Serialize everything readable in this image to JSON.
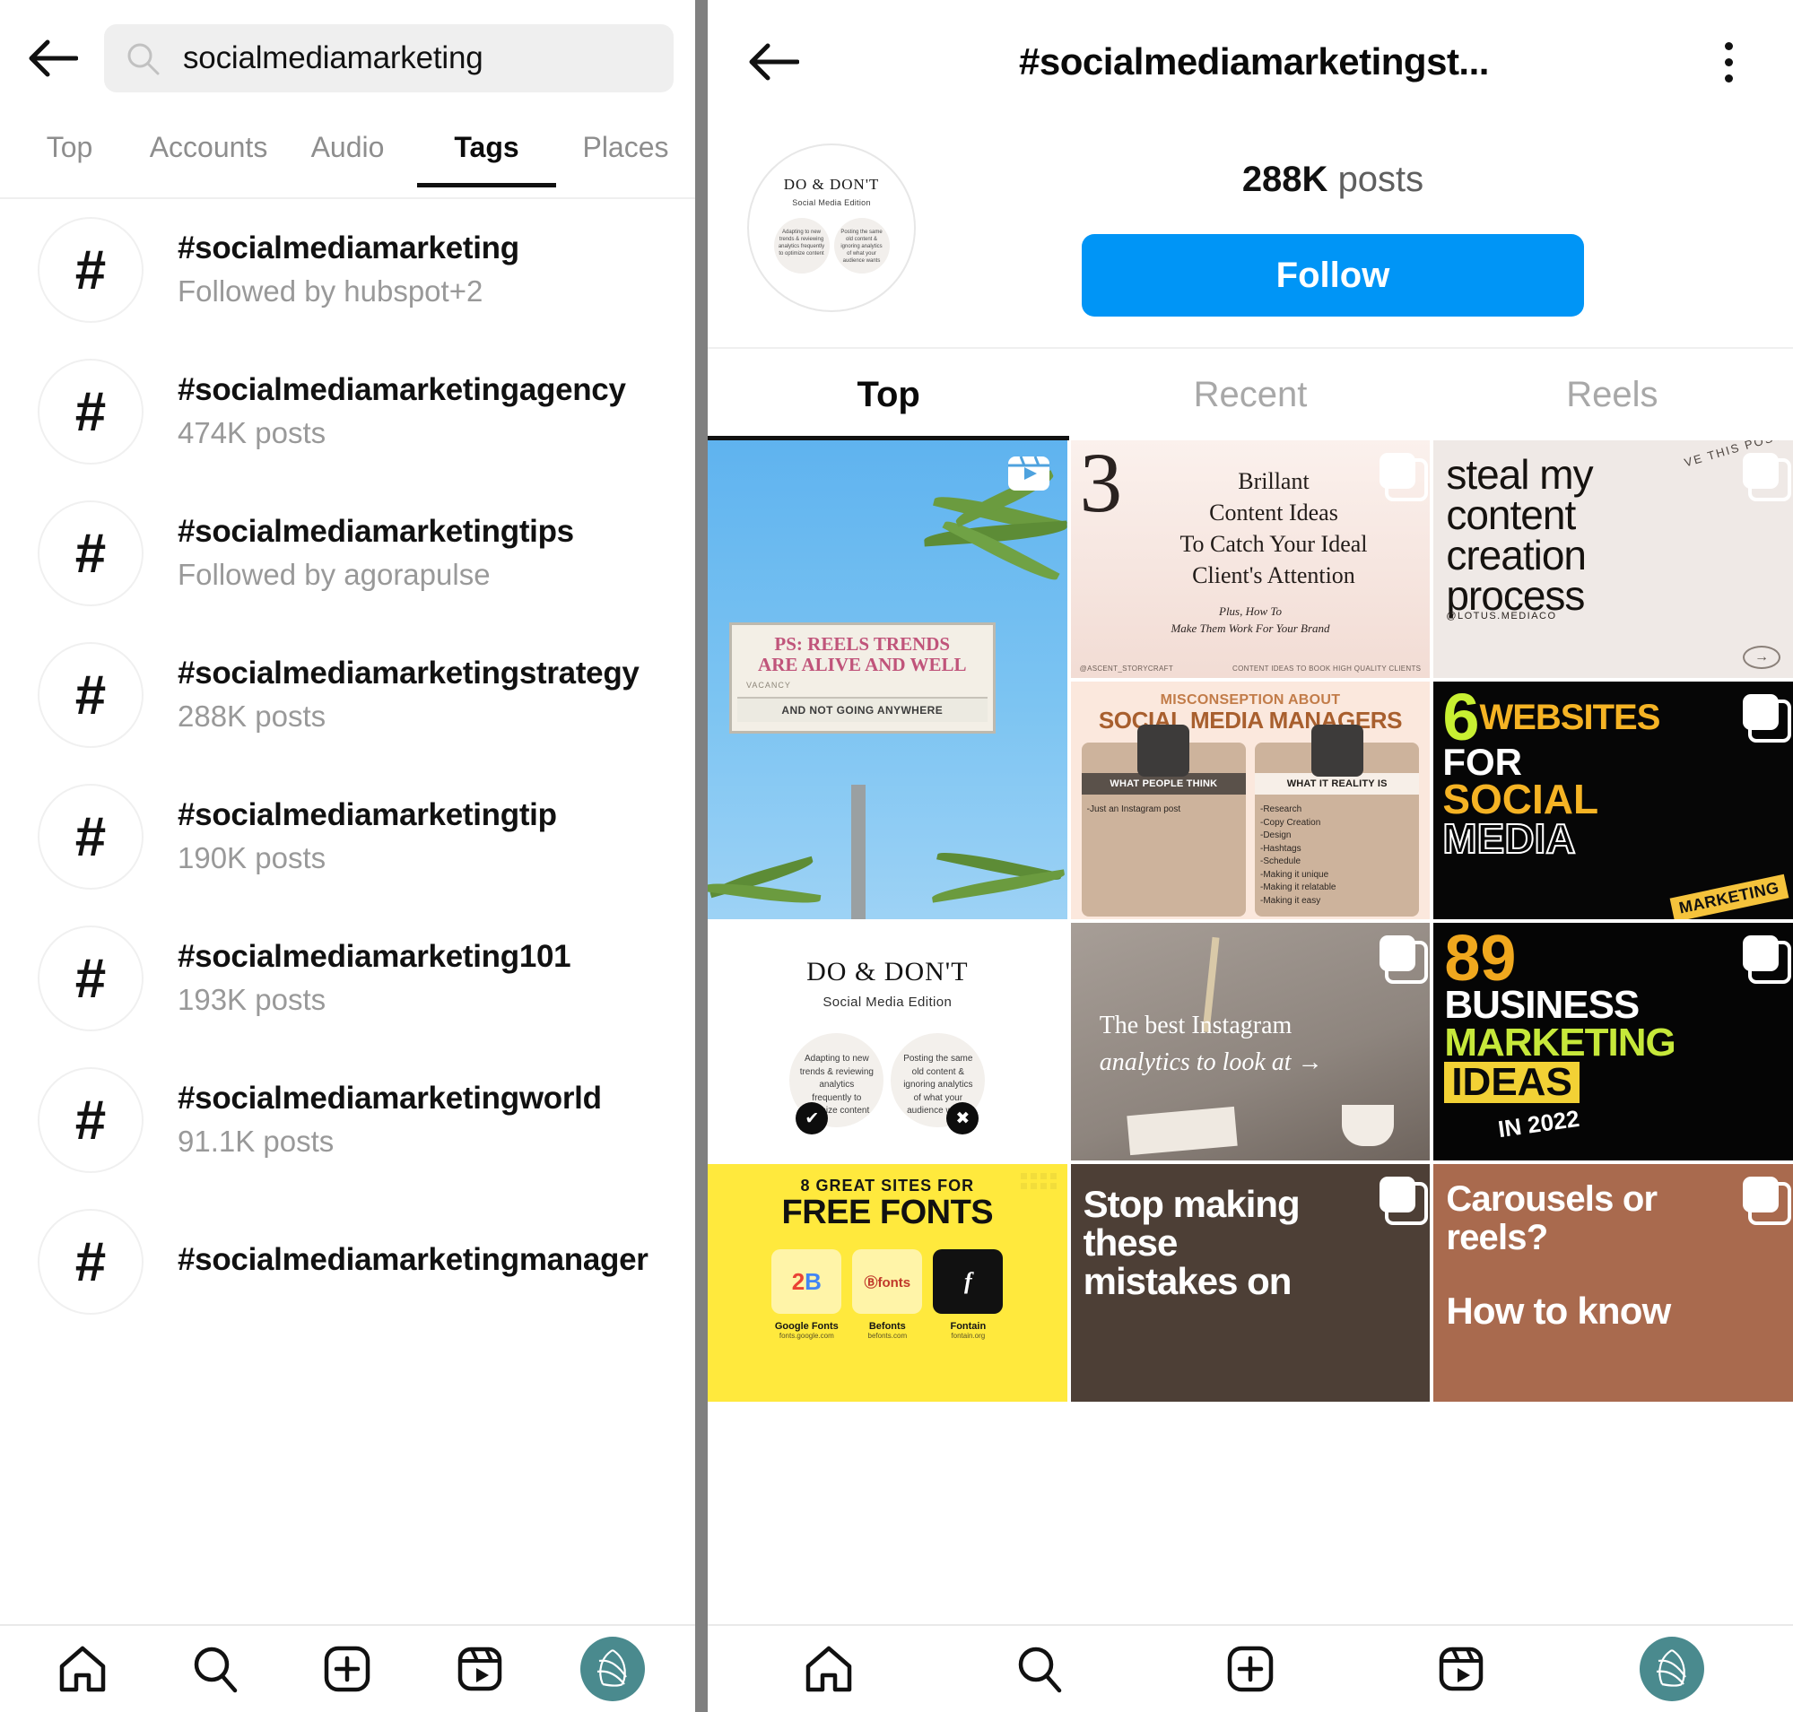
{
  "left": {
    "search": {
      "value": "socialmediamarketing",
      "placeholder": "Search"
    },
    "tabs": [
      {
        "label": "Top",
        "active": false
      },
      {
        "label": "Accounts",
        "active": false
      },
      {
        "label": "Audio",
        "active": false
      },
      {
        "label": "Tags",
        "active": true
      },
      {
        "label": "Places",
        "active": false
      }
    ],
    "hash_glyph": "#",
    "tags": [
      {
        "name": "#socialmediamarketing",
        "sub": "Followed by hubspot+2"
      },
      {
        "name": "#socialmediamarketingagency",
        "sub": "474K posts"
      },
      {
        "name": "#socialmediamarketingtips",
        "sub": "Followed by agorapulse"
      },
      {
        "name": "#socialmediamarketingstrategy",
        "sub": "288K posts"
      },
      {
        "name": "#socialmediamarketingtip",
        "sub": "190K posts"
      },
      {
        "name": "#socialmediamarketing101",
        "sub": "193K posts"
      },
      {
        "name": "#socialmediamarketingworld",
        "sub": "91.1K posts"
      },
      {
        "name": "#socialmediamarketingmanager",
        "sub": ""
      }
    ],
    "bottom_nav": [
      {
        "icon": "home-icon",
        "label": "Home"
      },
      {
        "icon": "search-icon",
        "label": "Search"
      },
      {
        "icon": "create-icon",
        "label": "Create"
      },
      {
        "icon": "reels-icon",
        "label": "Reels"
      },
      {
        "icon": "profile-avatar-icon",
        "label": "Profile"
      }
    ]
  },
  "right": {
    "title": "#socialmediamarketingst...",
    "back_icon": "back-arrow-icon",
    "menu_icon": "overflow-menu-icon",
    "posts_count": "288K",
    "posts_label": "posts",
    "follow_label": "Follow",
    "follow_color": "#0095f6",
    "avatar": {
      "title": "DO & DON'T",
      "subtitle": "Social Media Edition",
      "left_text": "Adapting to new trends & reviewing analytics frequently to optimize content",
      "right_text": "Posting the same old content & ignoring analytics of what your audience wants",
      "left_badge": "✔",
      "right_badge": "✖"
    },
    "tabs": [
      {
        "label": "Top",
        "active": true
      },
      {
        "label": "Recent",
        "active": false
      },
      {
        "label": "Reels",
        "active": false
      }
    ],
    "grid": [
      {
        "type": "reel",
        "badge": "reels-badge-icon",
        "board_line1": "PS: REELS TRENDS",
        "board_line1b": "ARE ALIVE AND WELL",
        "board_line2": "AND NOT GOING ANYWHERE",
        "board_vacancy": "VACANCY"
      },
      {
        "type": "carousel",
        "badge": "carousel-badge-icon",
        "num": "3",
        "l1": "Brillant",
        "l2": "Content Ideas",
        "l3": "To Catch Your Ideal",
        "l4": "Client's Attention",
        "plus1": "Plus, How To",
        "plus2": "Make Them Work For Your Brand",
        "foot_left": "@ASCENT_STORYCRAFT",
        "foot_right": "CONTENT IDEAS TO BOOK HIGH QUALITY CLIENTS"
      },
      {
        "type": "carousel",
        "badge": "carousel-badge-icon",
        "l1": "steal my",
        "l2": "content",
        "l3": "creation",
        "l4": "process",
        "handle": "@LOTUS.MEDIACO",
        "corner": "VE THIS POST",
        "arrow": "→"
      },
      {
        "type": "image",
        "title_top": "MISCONSEPTION ABOUT",
        "title_main": "SOCIAL MEDIA MANAGERS",
        "left_cap": "WHAT PEOPLE THINK",
        "left_body": "-Just an Instagram post",
        "right_cap": "WHAT IT REALITY IS",
        "right_body": "-Research\n-Copy Creation\n-Design\n-Hashtags\n-Schedule\n-Making it unique\n-Making it relatable\n-Making it easy"
      },
      {
        "type": "carousel",
        "badge": "carousel-badge-icon",
        "n": "6",
        "w": "WEBSITES",
        "l2": "FOR",
        "l3": "SOCIAL",
        "l4": "MEDIA",
        "stamp": "MARKETING"
      },
      {
        "type": "image",
        "title": "DO & DON'T",
        "subtitle": "Social Media Edition",
        "left_text": "Adapting to new trends & reviewing analytics frequently to optimize content",
        "right_text": "Posting the same old content & ignoring analytics of what your audience wants",
        "left_badge": "✔",
        "right_badge": "✖"
      },
      {
        "type": "carousel",
        "badge": "carousel-badge-icon",
        "l1": "The best Instagram",
        "l2": "analytics to look at →"
      },
      {
        "type": "carousel",
        "badge": "carousel-badge-icon",
        "n": "89",
        "b1": "BUSINESS",
        "b2": "MARKETING",
        "b3": "IDEAS",
        "yr": "IN 2022"
      },
      {
        "type": "image",
        "h1": "8 GREAT SITES FOR",
        "h2": "FREE FONTS",
        "cards": [
          {
            "name": "Google Fonts",
            "url": "fonts.google.com"
          },
          {
            "name": "Befonts",
            "url": "befonts.com"
          },
          {
            "name": "Fontain",
            "url": "fontain.org"
          }
        ]
      },
      {
        "type": "carousel",
        "badge": "carousel-badge-icon",
        "l1": "Stop making",
        "l2": "these",
        "l3": "mistakes on"
      },
      {
        "type": "carousel",
        "badge": "carousel-badge-icon",
        "l1": "Carousels or",
        "l2": "reels?",
        "l3": "How to know"
      }
    ],
    "bottom_nav": [
      {
        "icon": "home-icon",
        "label": "Home"
      },
      {
        "icon": "search-icon",
        "label": "Search"
      },
      {
        "icon": "create-icon",
        "label": "Create"
      },
      {
        "icon": "reels-icon",
        "label": "Reels"
      },
      {
        "icon": "profile-avatar-icon",
        "label": "Profile"
      }
    ]
  }
}
